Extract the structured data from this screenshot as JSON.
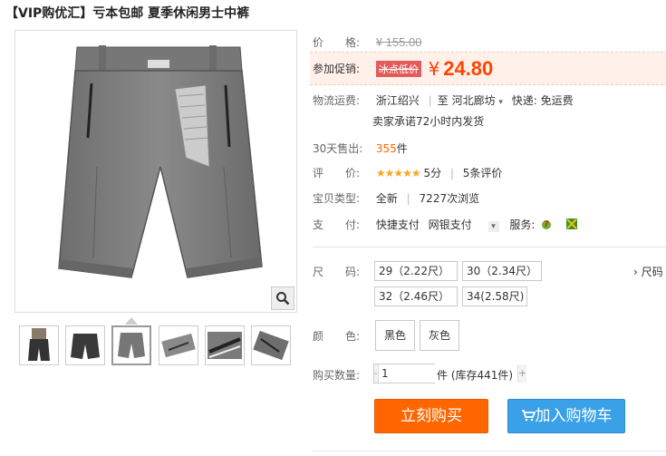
{
  "title": "【VIP购优汇】亏本包邮 夏季休闲男士中裤",
  "price": {
    "label": "价　　格:",
    "original": "¥ 155.00"
  },
  "promo": {
    "label": "参加促销:",
    "badge": "冰点低价",
    "currency": "¥",
    "value": "24.80"
  },
  "shipping": {
    "label": "物流运费:",
    "from": "浙江绍兴",
    "to_prefix": "至",
    "to": "河北廊坊",
    "fee": "快递: 免运费",
    "promise": "卖家承诺72小时内发货"
  },
  "sales": {
    "label": "30天售出:",
    "count": "355",
    "unit": "件"
  },
  "rating": {
    "label": "评　　价:",
    "stars": "★★★★★",
    "score": "5分",
    "reviews": "5条评价"
  },
  "item_type": {
    "label": "宝贝类型:",
    "condition": "全新",
    "views": "7227次浏览"
  },
  "payment": {
    "label": "支　　付:",
    "methods": [
      "快捷支付",
      "网银支付"
    ],
    "service_label": "服务:"
  },
  "size": {
    "label": "尺　　码:",
    "options": [
      "29（2.22尺）",
      "30（2.34尺）",
      "32（2.46尺）",
      "34(2.58尺)"
    ],
    "chart_link": "› 尺码"
  },
  "color": {
    "label": "颜　　色:",
    "options": [
      "黑色",
      "灰色"
    ]
  },
  "quantity": {
    "label": "购买数量:",
    "value": "1",
    "minus": "-",
    "plus": "+",
    "stock": "件 (库存441件)"
  },
  "buttons": {
    "buy": "立刻购买",
    "cart": "加入购物车"
  },
  "colors": {
    "price": "#ff4400",
    "buy_button": "#ff6600",
    "cart_button": "#3aa0e8"
  }
}
